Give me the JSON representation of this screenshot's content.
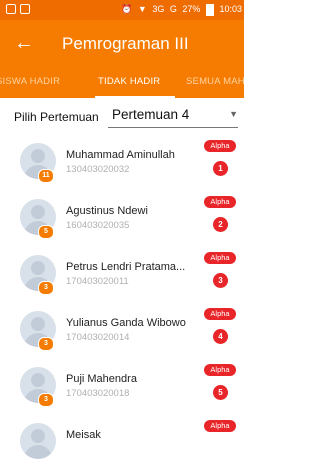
{
  "status_bar": {
    "network": "3G",
    "carrier": "G",
    "battery": "27%",
    "time": "10:03"
  },
  "app_bar": {
    "title": "Pemrograman III",
    "back_icon": "arrow-left-icon"
  },
  "tabs": [
    {
      "label": "SISWA HADIR",
      "active": false
    },
    {
      "label": "TIDAK HADIR",
      "active": true
    },
    {
      "label": "SEMUA MAH",
      "active": false
    }
  ],
  "filter": {
    "label": "Pilih Pertemuan",
    "selected": "Pertemuan 4"
  },
  "students": [
    {
      "name": "Muhammad Aminullah",
      "nim": "130403020032",
      "count": "11",
      "status": "Alpha",
      "status_count": "1"
    },
    {
      "name": "Agustinus Ndewi",
      "nim": "160403020035",
      "count": "5",
      "status": "Alpha",
      "status_count": "2"
    },
    {
      "name": "Petrus Lendri Pratama...",
      "nim": "170403020011",
      "count": "3",
      "status": "Alpha",
      "status_count": "3"
    },
    {
      "name": "Yulianus Ganda Wibowo",
      "nim": "170403020014",
      "count": "3",
      "status": "Alpha",
      "status_count": "4"
    },
    {
      "name": "Puji Mahendra",
      "nim": "170403020018",
      "count": "3",
      "status": "Alpha",
      "status_count": "5"
    },
    {
      "name": "Meisak",
      "nim": "",
      "count": "",
      "status": "Alpha",
      "status_count": ""
    }
  ],
  "colors": {
    "primary": "#f57c00",
    "alert": "#e8262a"
  }
}
